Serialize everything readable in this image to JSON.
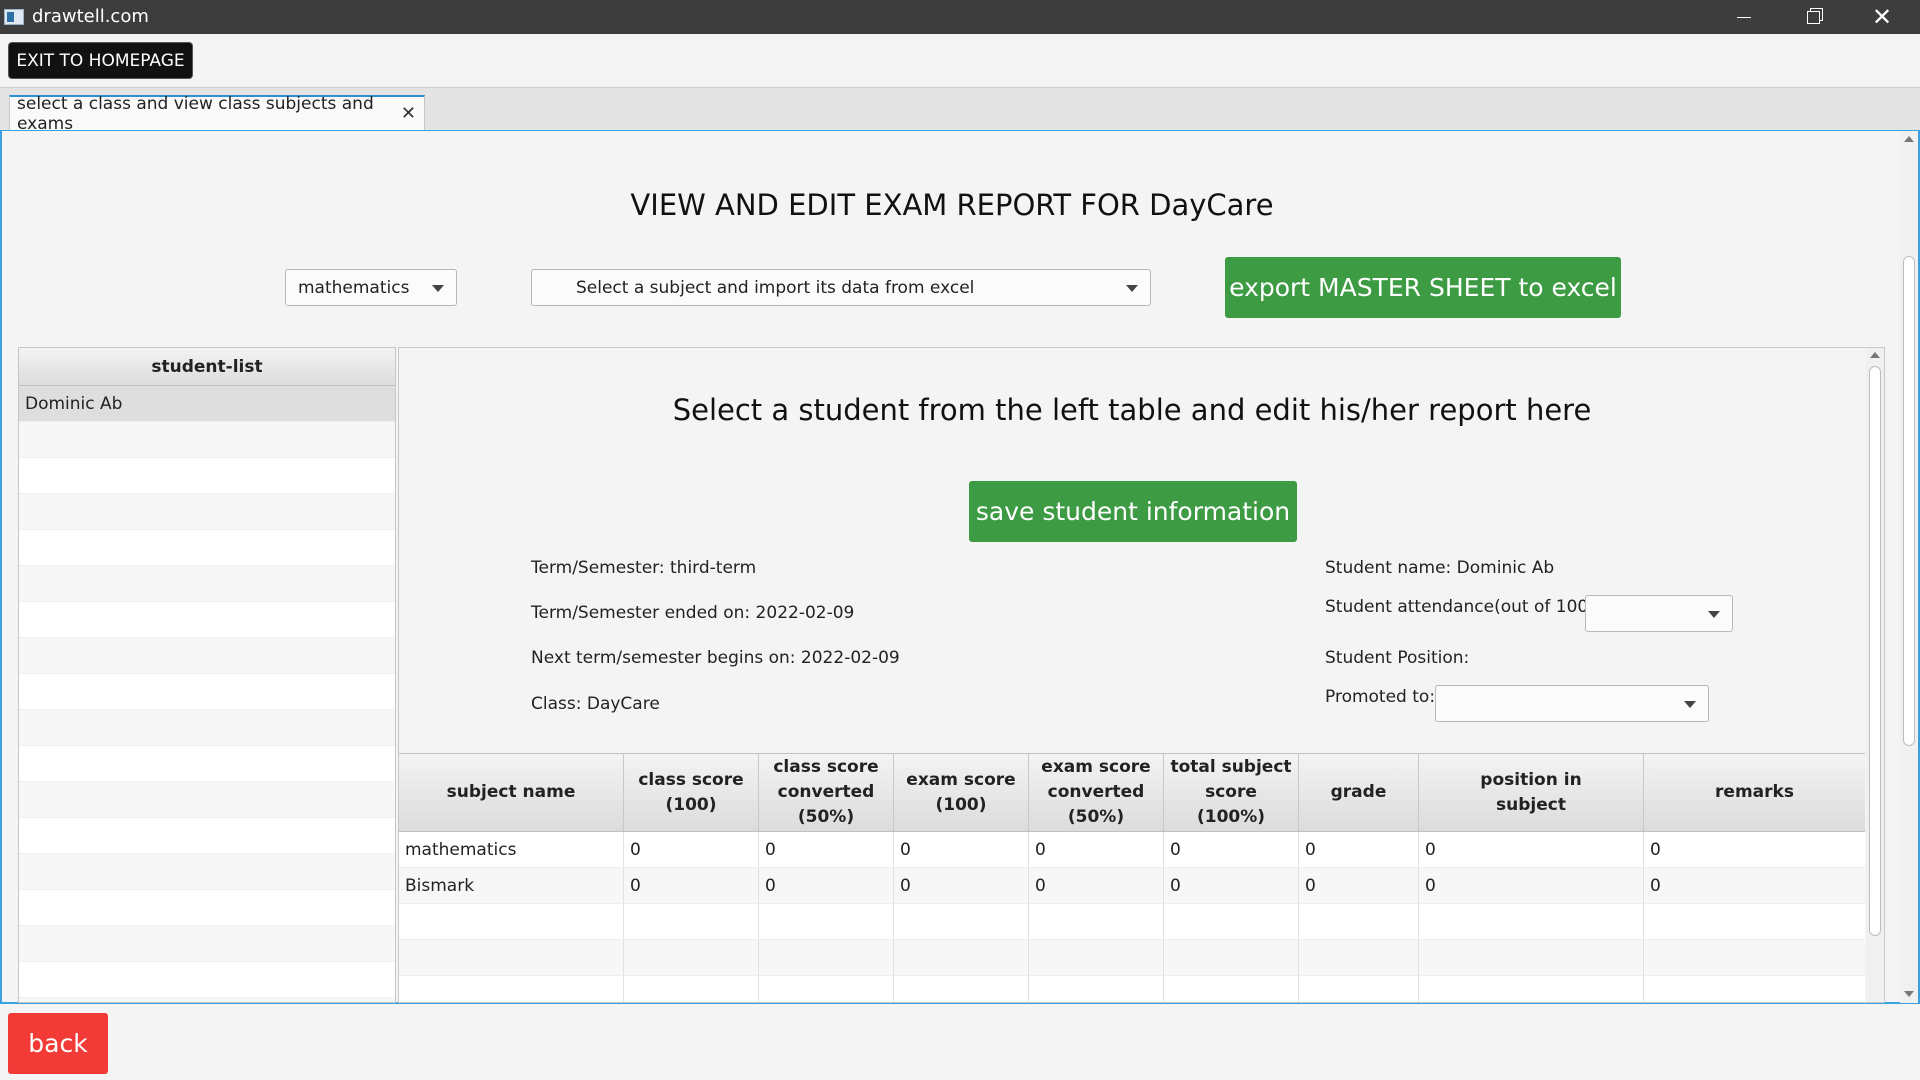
{
  "window": {
    "title": "drawtell.com",
    "minimize_icon": "minimize-icon",
    "maximize_icon": "restore-icon",
    "close_glyph": "✕"
  },
  "toolbar": {
    "exit_label": "EXIT TO HOMEPAGE"
  },
  "tabs": [
    {
      "label": "select a class and view class subjects and exams",
      "close_glyph": "✕"
    }
  ],
  "main": {
    "title": "VIEW AND EDIT EXAM REPORT FOR DayCare",
    "subject_select": {
      "value": "mathematics"
    },
    "import_select": {
      "value": "Select a subject and import its data from excel"
    },
    "export_label": "export MASTER SHEET to excel"
  },
  "student_list": {
    "header": "student-list",
    "items": [
      "Dominic Ab"
    ]
  },
  "report": {
    "heading": "Select a student from the left table and edit his/her report here",
    "save_label": "save student information",
    "term": "Term/Semester: third-term",
    "term_ended": "Term/Semester ended on: 2022-02-09",
    "next_term": "Next term/semester begins on: 2022-02-09",
    "class": "Class: DayCare",
    "student_name": "Student name: Dominic Ab",
    "attendance_label": "Student attendance(out of 100):",
    "attendance_value": "",
    "position_label": "Student Position:",
    "promoted_label": "Promoted to:",
    "promoted_value": ""
  },
  "subjects_table": {
    "headers": {
      "subject_name": "subject name",
      "class_score_1": "class score",
      "class_score_2": "(100)",
      "class_conv_1": "class score",
      "class_conv_2": "converted",
      "class_conv_3": "(50%)",
      "exam_score_1": "exam score",
      "exam_score_2": "(100)",
      "exam_conv_1": "exam score",
      "exam_conv_2": "converted",
      "exam_conv_3": "(50%)",
      "total_1": "total subject",
      "total_2": "score (100%)",
      "grade": "grade",
      "position_1": "position in",
      "position_2": "subject",
      "remarks": "remarks"
    },
    "rows": [
      [
        "mathematics",
        "0",
        "0",
        "0",
        "0",
        "0",
        "0",
        "0",
        "0"
      ],
      [
        "Bismark",
        "0",
        "0",
        "0",
        "0",
        "0",
        "0",
        "0",
        "0"
      ]
    ]
  },
  "footer": {
    "back_label": "back"
  },
  "colors": {
    "titlebar": "#3d3d3d",
    "accent_green": "#3d9c43",
    "back_red": "#f23b36",
    "tab_accent": "#2d8fd6"
  }
}
